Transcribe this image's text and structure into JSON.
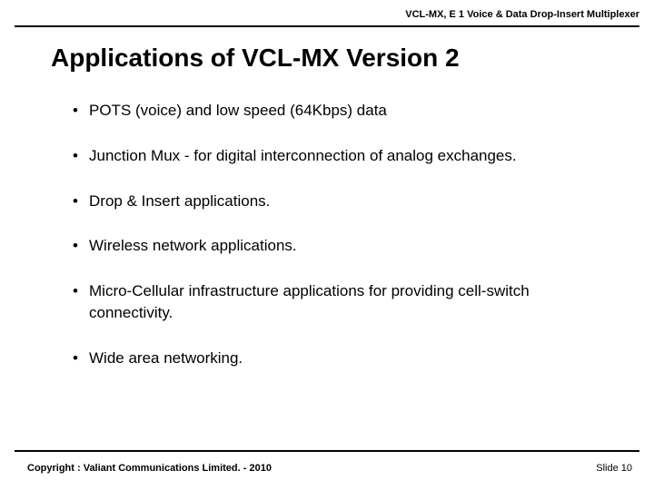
{
  "header": {
    "product": "VCL-MX, E 1 Voice & Data Drop-Insert Multiplexer"
  },
  "title": "Applications of VCL-MX Version 2",
  "bullets": [
    "POTS (voice) and low speed (64Kbps) data",
    "Junction Mux - for digital interconnection of analog exchanges.",
    "Drop & Insert applications.",
    "Wireless network applications.",
    "Micro-Cellular infrastructure applications for providing cell-switch connectivity.",
    "Wide area networking."
  ],
  "footer": {
    "copyright": "Copyright : Valiant Communications Limited. - 2010",
    "slide": "Slide 10"
  }
}
